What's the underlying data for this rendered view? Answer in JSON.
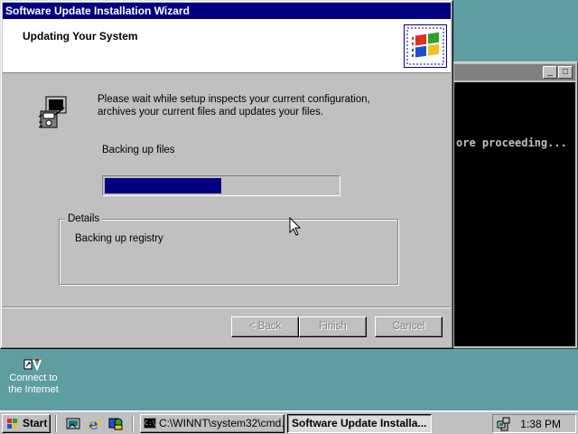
{
  "wizard": {
    "title": "Software Update Installation Wizard",
    "header_title": "Updating Your System",
    "info_text": "Please wait while setup inspects your current configuration, archives your current files and updates your files.",
    "progress_label": "Backing up files",
    "progress_fraction": 0.5,
    "details_legend": "Details",
    "details_text": "Backing up registry",
    "buttons": {
      "back": "< Back",
      "finish": "Finish",
      "cancel": "Cancel"
    }
  },
  "console": {
    "output_text": "ore proceeding...",
    "min_symbol": "_",
    "max_symbol": "□"
  },
  "desktop": {
    "icon_label": "Connect to the Internet"
  },
  "taskbar": {
    "start_label": "Start",
    "tasks": [
      {
        "label": "C:\\WINNT\\system32\\cmd...",
        "active": false
      },
      {
        "label": "Software Update Installa...",
        "active": true
      }
    ],
    "clock": "1:38 PM"
  },
  "colors": {
    "titlebar_active": "#000080",
    "titlebar_inactive": "#808080",
    "progress": "#000080",
    "desktop": "#5f9ea0",
    "face": "#c0c0c0"
  },
  "icons": [
    "windows-logo-icon",
    "setup-computer-icon",
    "connect-internet-icon",
    "show-desktop-icon",
    "internet-explorer-icon",
    "channels-icon",
    "cmd-icon",
    "network-tray-icon",
    "mouse-cursor-icon"
  ]
}
